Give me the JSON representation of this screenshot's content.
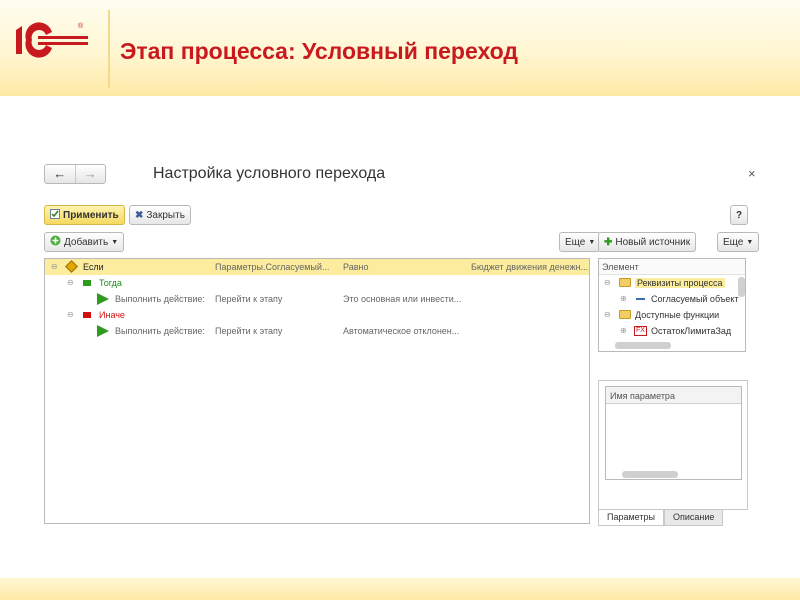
{
  "slide": {
    "title": "Этап процесса: Условный переход",
    "logo_text": "1С"
  },
  "form": {
    "title": "Настройка условного перехода",
    "nav_back": "←",
    "nav_forward": "→",
    "close_glyph": "×",
    "toolbar": {
      "apply_label": "Применить",
      "close_label": "Закрыть",
      "help_label": "?",
      "add_label": "Добавить",
      "more_label": "Еще",
      "new_source_label": "Новый источник"
    }
  },
  "tree": {
    "if_row": {
      "label": "Если",
      "col1": "Параметры.Согласуемый...",
      "col2": "Равно",
      "col3": "Бюджет движения денежн..."
    },
    "then_row": {
      "label": "Тогда"
    },
    "then_action": {
      "label": "Выполнить действие:",
      "col1": "Перейти к этапу",
      "col2": "Это основная или инвести..."
    },
    "else_row": {
      "label": "Иначе"
    },
    "else_action": {
      "label": "Выполнить действие:",
      "col1": "Перейти к этапу",
      "col2": "Автоматическое отклонен..."
    }
  },
  "elements_panel": {
    "header": "Элемент",
    "items": [
      {
        "label": "Реквизиты процесса",
        "kind": "folder",
        "selected": true
      },
      {
        "label": "Согласуемый объект",
        "kind": "field"
      },
      {
        "label": "Доступные функции",
        "kind": "folder"
      },
      {
        "label": "ОстатокЛимитаЗад",
        "kind": "function"
      }
    ]
  },
  "params_panel": {
    "column_header": "Имя параметра",
    "tabs": [
      "Параметры",
      "Описание"
    ]
  },
  "colors": {
    "title_red": "#c8191f",
    "selection_yellow": "#fbec9e",
    "then_green": "#1f8a1a",
    "else_red": "#d01010"
  }
}
